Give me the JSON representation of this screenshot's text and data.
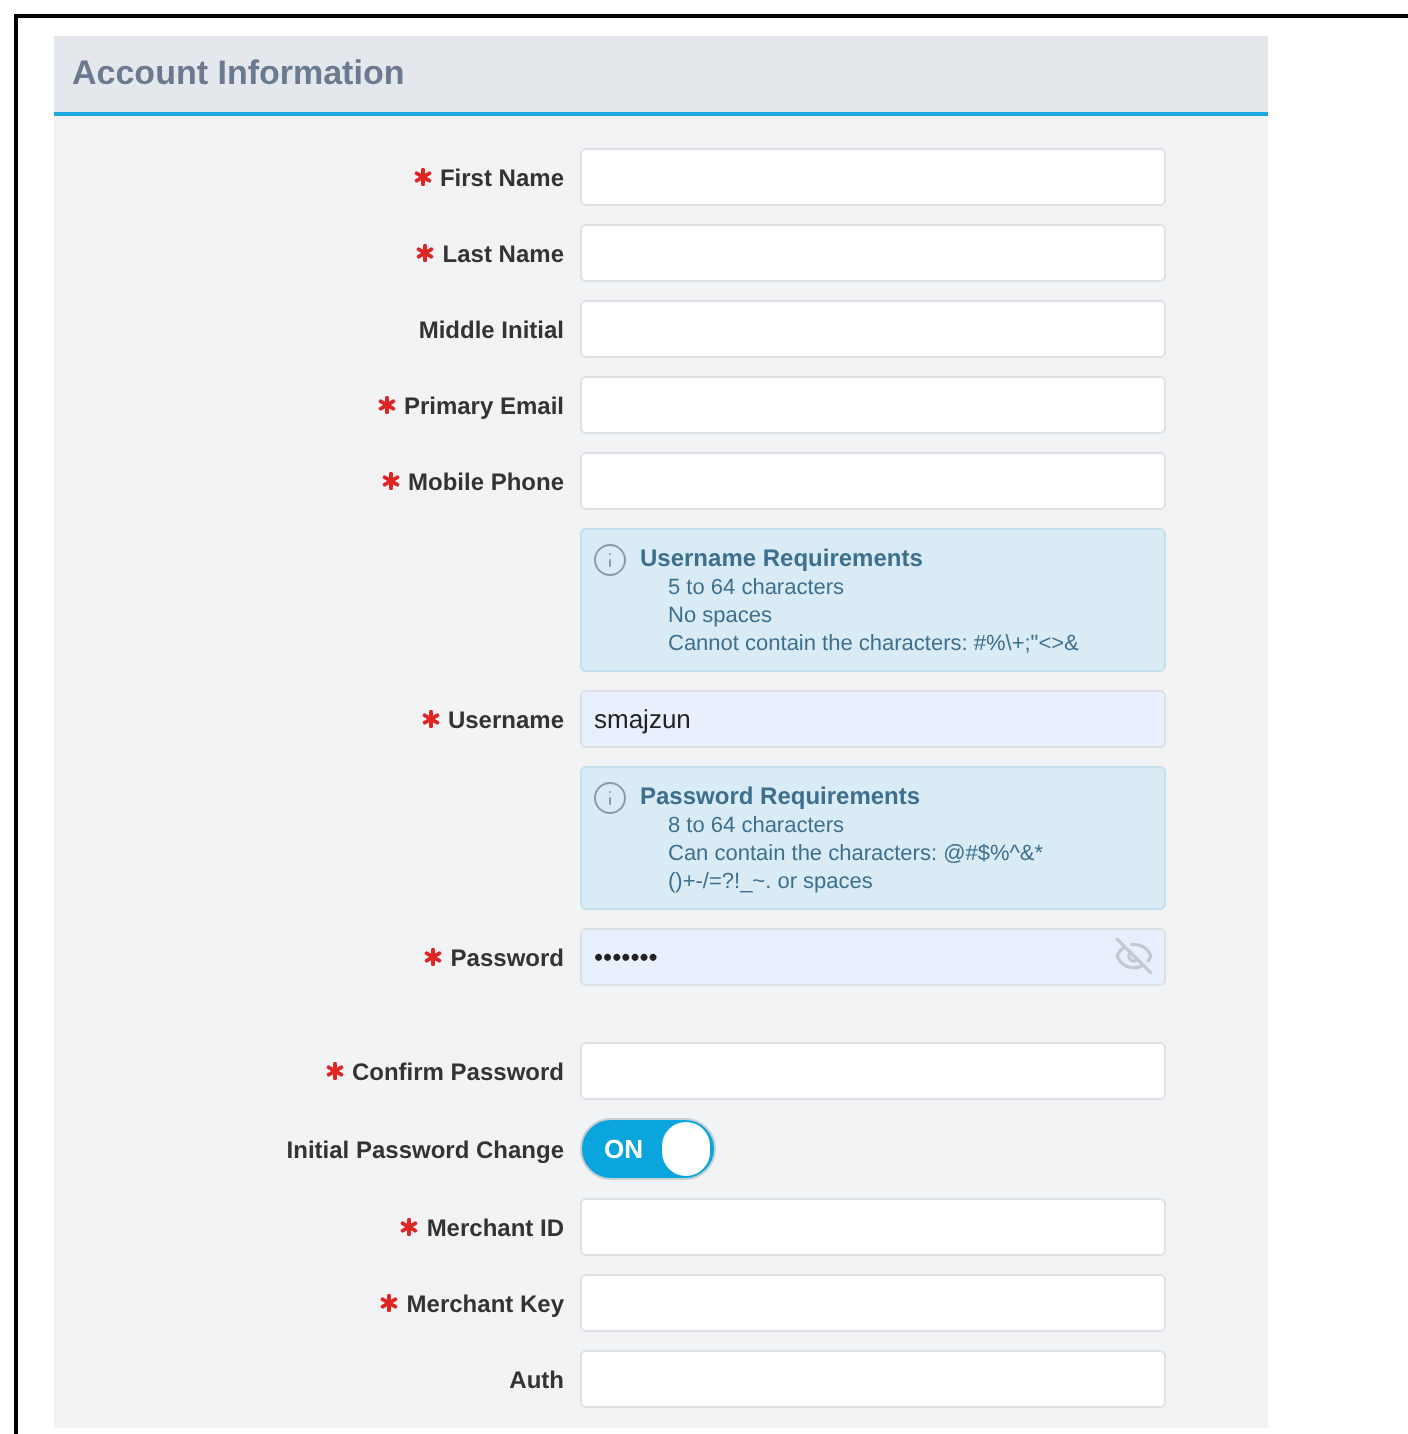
{
  "panel": {
    "title": "Account Information"
  },
  "rows": [
    {
      "kind": "text",
      "label": "First Name",
      "required": true,
      "value": "",
      "autofilled": false
    },
    {
      "kind": "text",
      "label": "Last Name",
      "required": true,
      "value": "",
      "autofilled": false
    },
    {
      "kind": "text",
      "label": "Middle Initial",
      "required": false,
      "value": "",
      "autofilled": false
    },
    {
      "kind": "text",
      "label": "Primary Email",
      "required": true,
      "value": "",
      "autofilled": false
    },
    {
      "kind": "text",
      "label": "Mobile Phone",
      "required": true,
      "value": "",
      "autofilled": false
    },
    {
      "kind": "info",
      "title": "Username Requirements",
      "lines": [
        "5 to 64 characters",
        "No spaces",
        "Cannot contain the characters: #%\\+;\"<>&"
      ]
    },
    {
      "kind": "text",
      "label": "Username",
      "required": true,
      "value": "smajzun",
      "autofilled": true
    },
    {
      "kind": "info",
      "title": "Password Requirements",
      "lines": [
        "8 to 64 characters",
        "Can contain the characters: @#$%^&*",
        "()+-/=?!_~. or spaces"
      ]
    },
    {
      "kind": "password",
      "label": "Password",
      "required": true,
      "value": "•••••••",
      "autofilled": true
    },
    {
      "kind": "text",
      "label": "Confirm Password",
      "required": true,
      "value": "",
      "autofilled": false
    },
    {
      "kind": "toggle",
      "label": "Initial Password Change",
      "on": true,
      "state_text": "ON"
    },
    {
      "kind": "text",
      "label": "Merchant ID",
      "required": true,
      "value": "",
      "autofilled": false
    },
    {
      "kind": "text",
      "label": "Merchant Key",
      "required": true,
      "value": "",
      "autofilled": false
    },
    {
      "kind": "text",
      "label": "Auth",
      "required": false,
      "value": "",
      "autofilled": false
    }
  ]
}
